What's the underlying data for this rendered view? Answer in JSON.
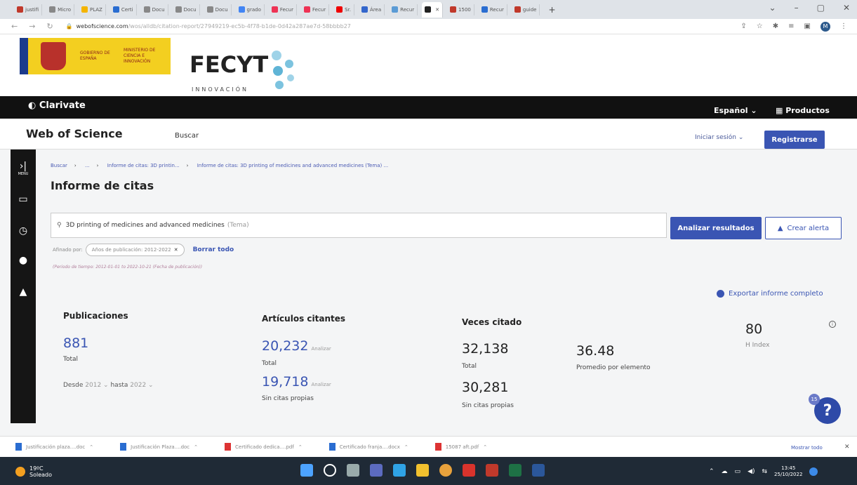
{
  "browser": {
    "tabs": [
      "justifi",
      "Micro",
      "PLAZ",
      "Certi",
      "Docu",
      "Docu",
      "Docu",
      "grado",
      "Fecur",
      "Fecur",
      "Sr.",
      "Área",
      "Recur",
      "",
      "1500",
      "Recur",
      "guide"
    ],
    "url_prefix": "webofscience.com",
    "url_rest": "/wos/alldb/citation-report/27949219-ec5b-4f78-b1de-0d42a287ae7d-58bbbb27",
    "new_tab": "+",
    "profile_initial": "M"
  },
  "banner": {
    "gov_line1": "GOBIERNO DE ESPAÑA",
    "gov_line2": "MINISTERIO DE CIENCIA E INNOVACIÓN",
    "fecyt": "FECYT",
    "fecyt_sub": "INNOVACIÓN"
  },
  "topbar": {
    "brand": "Clarivate",
    "language": "Español ⌄",
    "products": "Productos"
  },
  "wos": {
    "title": "Web of Science",
    "search_link": "Buscar",
    "login": "Iniciar sesión ⌄",
    "register": "Registrarse"
  },
  "sidebar": {
    "menu_label": "MENU"
  },
  "breadcrumb": {
    "items": [
      "Buscar",
      "...",
      "Informe de citas: 3D printin...",
      "Informe de citas: 3D printing of medicines and advanced medicines (Tema) ..."
    ]
  },
  "page": {
    "title": "Informe de citas",
    "search_query": "3D printing of medicines and advanced medicines",
    "search_field": "(Tema)",
    "analyze_button": "Analizar resultados",
    "alert_button": "Crear alerta",
    "refined_by": "Afinado por:",
    "filter_chip": "Años de publicación: 2012-2022",
    "clear_all": "Borrar todo",
    "period_note": "(Periodo de tiempo: 2012-01-01 to 2022-10-21 (Fecha de publicación))",
    "export": "Exportar informe completo"
  },
  "stats": {
    "pubs_title": "Publicaciones",
    "pubs_value": "881",
    "pubs_label": "Total",
    "from_label": "Desde",
    "from_value": "2012 ⌄",
    "to_label": "hasta",
    "to_value": "2022 ⌄",
    "citing_title": "Artículos citantes",
    "citing_total": "20,232",
    "citing_total_label": "Total",
    "citing_self": "19,718",
    "citing_self_label": "Sin citas propias",
    "analyze": "Analizar",
    "cited_title": "Veces citado",
    "cited_total": "32,138",
    "cited_total_label": "Total",
    "cited_self": "30,281",
    "cited_self_label": "Sin citas propias",
    "avg_value": "36.48",
    "avg_label": "Promedio por elemento",
    "h_value": "80",
    "h_label": "H Index",
    "help_badge": "15",
    "help": "?"
  },
  "downloads": {
    "files": [
      "Justificación plaza....doc",
      "Justificación Plaza....doc",
      "Certificado dedica....pdf",
      "Certificado franja....docx",
      "15087 aft.pdf"
    ],
    "show_all": "Mostrar todo"
  },
  "taskbar": {
    "temp": "19ºC",
    "weather": "Soleado",
    "time": "13:45",
    "date": "25/10/2022"
  },
  "colors": {
    "accent": "#3a55b3",
    "black_bar": "#111111",
    "gov_yellow": "#f3cf20"
  }
}
